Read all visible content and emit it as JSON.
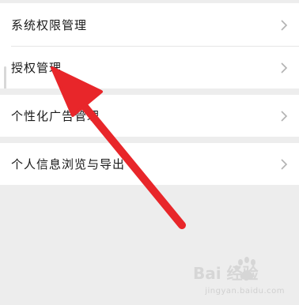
{
  "menu": {
    "items": [
      {
        "label": "系统权限管理"
      },
      {
        "label": "授权管理"
      },
      {
        "label": "个性化广告管理"
      },
      {
        "label": "个人信息浏览与导出"
      }
    ]
  },
  "watermark": {
    "brand": "Bai 经验",
    "url": "jingyan.baidu.com"
  },
  "colors": {
    "background": "#ededed",
    "row": "#ffffff",
    "text": "#1a1a1a",
    "chevron": "#b2b2b2",
    "annotation_arrow": "#e8262a"
  },
  "icons": [
    "chevron-right-icon",
    "annotation-arrow-icon",
    "baidu-paw-icon"
  ]
}
